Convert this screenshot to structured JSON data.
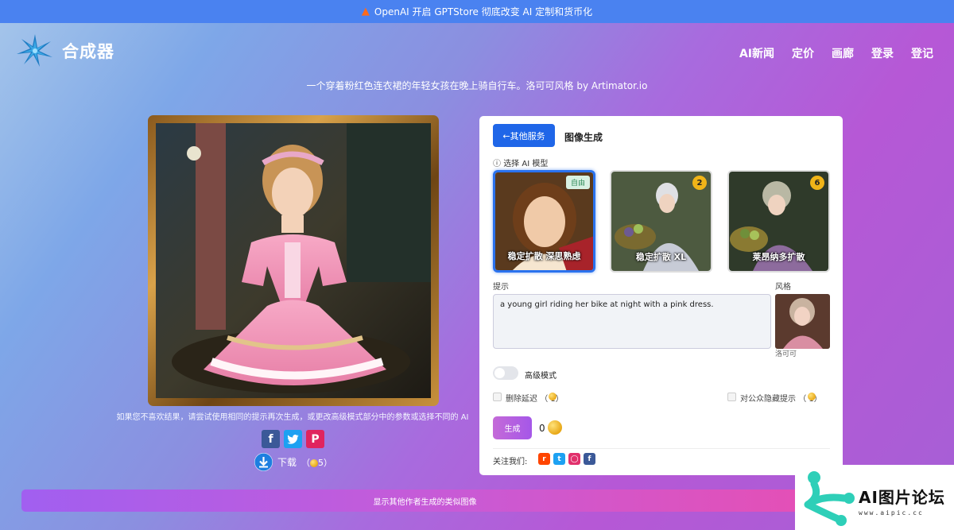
{
  "banner": {
    "icon": "fire-icon",
    "text": "OpenAI 开启 GPTStore 彻底改变 AI 定制和货币化"
  },
  "header": {
    "logo_text": "合成器",
    "nav": [
      "AI新闻",
      "定价",
      "画廊",
      "登录",
      "登记"
    ]
  },
  "subtitle": "一个穿着粉红色连衣裙的年轻女孩在晚上骑自行车。洛可可风格 by Artimator.io",
  "image_hint": "如果您不喜欢结果，请尝试使用相同的提示再次生成，或更改高级模式部分中的参数或选择不同的 AI",
  "share_icons": [
    "facebook-icon",
    "twitter-icon",
    "pinterest-icon"
  ],
  "download": {
    "label": "下载",
    "cost_prefix": "（",
    "cost": "5",
    "cost_suffix": "）"
  },
  "panel": {
    "back_label": "←其他服务",
    "title": "图像生成",
    "model_label": "选择 AI 模型",
    "models": [
      {
        "name": "稳定扩散 深思熟虑",
        "badge": "自由",
        "selected": true
      },
      {
        "name": "稳定扩散 XL",
        "badge": "2",
        "selected": false
      },
      {
        "name": "莱昂纳多扩散",
        "badge": "6",
        "selected": false
      }
    ],
    "prompt_label": "提示",
    "prompt_value": "a young girl riding her bike at night with a pink dress.",
    "style_label": "风格",
    "style_name": "洛可可",
    "advanced_label": "高级模式",
    "advanced_on": false,
    "remove_delay_label": "删除延迟",
    "remove_delay_cost": "（ 1）",
    "hide_prompt_label": "对公众隐藏提示",
    "hide_prompt_cost": "（ 1）",
    "generate_label": "生成",
    "balance": "0",
    "follow_label": "关注我们:",
    "follow_icons": [
      "reddit-icon",
      "twitter-icon",
      "instagram-icon",
      "facebook-icon"
    ]
  },
  "show_similar_label": "显示其他作者生成的类似图像",
  "watermark": {
    "text": "AI图片论坛",
    "url": "www.aipic.cc"
  },
  "colors": {
    "accent_blue": "#1f66e8",
    "topbar": "#4a82f0",
    "coin": "#e8a817"
  }
}
